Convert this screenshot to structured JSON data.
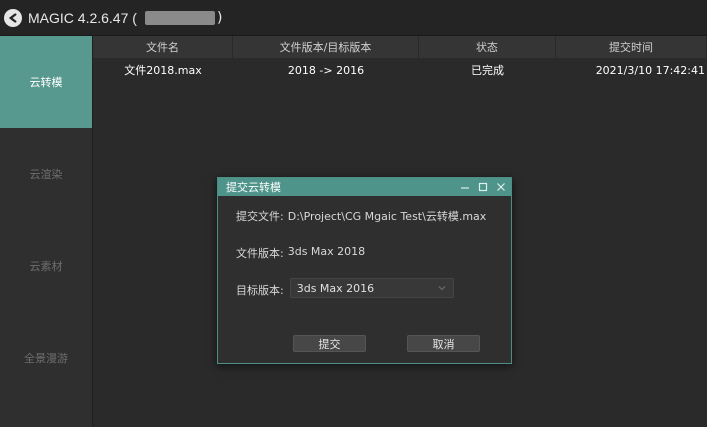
{
  "app": {
    "title": "MAGIC 4.2.6.47 (",
    "title_end": ")"
  },
  "sidebar": {
    "items": [
      {
        "label": "云转模",
        "active": true
      },
      {
        "label": "云渲染",
        "active": false
      },
      {
        "label": "云素材",
        "active": false
      },
      {
        "label": "全景漫游",
        "active": false
      }
    ]
  },
  "table": {
    "columns": [
      "文件名",
      "文件版本/目标版本",
      "状态",
      "提交时间"
    ],
    "rows": [
      [
        "文件2018.max",
        "2018 -> 2016",
        "已完成",
        "2021/3/10 17:42:41"
      ]
    ]
  },
  "dialog": {
    "title": "提交云转模",
    "file_label": "提交文件:",
    "file_value": "D:\\Project\\CG Mgaic Test\\云转模.max",
    "version_label": "文件版本:",
    "version_value": "3ds Max 2018",
    "target_label": "目标版本:",
    "target_value": "3ds Max 2016",
    "submit_label": "提交",
    "cancel_label": "取消"
  },
  "colors": {
    "accent": "#58998f",
    "dialog_title": "#4f948a"
  }
}
